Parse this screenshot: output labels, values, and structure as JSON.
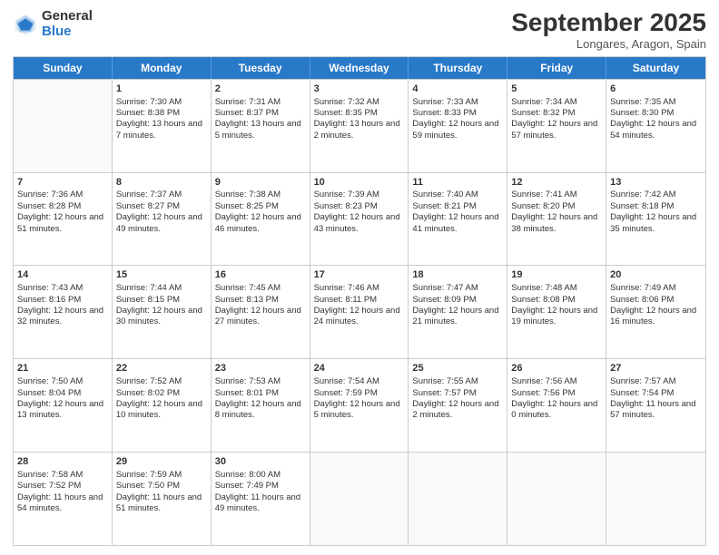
{
  "logo": {
    "general": "General",
    "blue": "Blue"
  },
  "header": {
    "month": "September 2025",
    "location": "Longares, Aragon, Spain"
  },
  "weekdays": [
    "Sunday",
    "Monday",
    "Tuesday",
    "Wednesday",
    "Thursday",
    "Friday",
    "Saturday"
  ],
  "rows": [
    [
      {
        "day": "",
        "empty": true
      },
      {
        "day": "1",
        "sunrise": "Sunrise: 7:30 AM",
        "sunset": "Sunset: 8:38 PM",
        "daylight": "Daylight: 13 hours and 7 minutes."
      },
      {
        "day": "2",
        "sunrise": "Sunrise: 7:31 AM",
        "sunset": "Sunset: 8:37 PM",
        "daylight": "Daylight: 13 hours and 5 minutes."
      },
      {
        "day": "3",
        "sunrise": "Sunrise: 7:32 AM",
        "sunset": "Sunset: 8:35 PM",
        "daylight": "Daylight: 13 hours and 2 minutes."
      },
      {
        "day": "4",
        "sunrise": "Sunrise: 7:33 AM",
        "sunset": "Sunset: 8:33 PM",
        "daylight": "Daylight: 12 hours and 59 minutes."
      },
      {
        "day": "5",
        "sunrise": "Sunrise: 7:34 AM",
        "sunset": "Sunset: 8:32 PM",
        "daylight": "Daylight: 12 hours and 57 minutes."
      },
      {
        "day": "6",
        "sunrise": "Sunrise: 7:35 AM",
        "sunset": "Sunset: 8:30 PM",
        "daylight": "Daylight: 12 hours and 54 minutes."
      }
    ],
    [
      {
        "day": "7",
        "sunrise": "Sunrise: 7:36 AM",
        "sunset": "Sunset: 8:28 PM",
        "daylight": "Daylight: 12 hours and 51 minutes."
      },
      {
        "day": "8",
        "sunrise": "Sunrise: 7:37 AM",
        "sunset": "Sunset: 8:27 PM",
        "daylight": "Daylight: 12 hours and 49 minutes."
      },
      {
        "day": "9",
        "sunrise": "Sunrise: 7:38 AM",
        "sunset": "Sunset: 8:25 PM",
        "daylight": "Daylight: 12 hours and 46 minutes."
      },
      {
        "day": "10",
        "sunrise": "Sunrise: 7:39 AM",
        "sunset": "Sunset: 8:23 PM",
        "daylight": "Daylight: 12 hours and 43 minutes."
      },
      {
        "day": "11",
        "sunrise": "Sunrise: 7:40 AM",
        "sunset": "Sunset: 8:21 PM",
        "daylight": "Daylight: 12 hours and 41 minutes."
      },
      {
        "day": "12",
        "sunrise": "Sunrise: 7:41 AM",
        "sunset": "Sunset: 8:20 PM",
        "daylight": "Daylight: 12 hours and 38 minutes."
      },
      {
        "day": "13",
        "sunrise": "Sunrise: 7:42 AM",
        "sunset": "Sunset: 8:18 PM",
        "daylight": "Daylight: 12 hours and 35 minutes."
      }
    ],
    [
      {
        "day": "14",
        "sunrise": "Sunrise: 7:43 AM",
        "sunset": "Sunset: 8:16 PM",
        "daylight": "Daylight: 12 hours and 32 minutes."
      },
      {
        "day": "15",
        "sunrise": "Sunrise: 7:44 AM",
        "sunset": "Sunset: 8:15 PM",
        "daylight": "Daylight: 12 hours and 30 minutes."
      },
      {
        "day": "16",
        "sunrise": "Sunrise: 7:45 AM",
        "sunset": "Sunset: 8:13 PM",
        "daylight": "Daylight: 12 hours and 27 minutes."
      },
      {
        "day": "17",
        "sunrise": "Sunrise: 7:46 AM",
        "sunset": "Sunset: 8:11 PM",
        "daylight": "Daylight: 12 hours and 24 minutes."
      },
      {
        "day": "18",
        "sunrise": "Sunrise: 7:47 AM",
        "sunset": "Sunset: 8:09 PM",
        "daylight": "Daylight: 12 hours and 21 minutes."
      },
      {
        "day": "19",
        "sunrise": "Sunrise: 7:48 AM",
        "sunset": "Sunset: 8:08 PM",
        "daylight": "Daylight: 12 hours and 19 minutes."
      },
      {
        "day": "20",
        "sunrise": "Sunrise: 7:49 AM",
        "sunset": "Sunset: 8:06 PM",
        "daylight": "Daylight: 12 hours and 16 minutes."
      }
    ],
    [
      {
        "day": "21",
        "sunrise": "Sunrise: 7:50 AM",
        "sunset": "Sunset: 8:04 PM",
        "daylight": "Daylight: 12 hours and 13 minutes."
      },
      {
        "day": "22",
        "sunrise": "Sunrise: 7:52 AM",
        "sunset": "Sunset: 8:02 PM",
        "daylight": "Daylight: 12 hours and 10 minutes."
      },
      {
        "day": "23",
        "sunrise": "Sunrise: 7:53 AM",
        "sunset": "Sunset: 8:01 PM",
        "daylight": "Daylight: 12 hours and 8 minutes."
      },
      {
        "day": "24",
        "sunrise": "Sunrise: 7:54 AM",
        "sunset": "Sunset: 7:59 PM",
        "daylight": "Daylight: 12 hours and 5 minutes."
      },
      {
        "day": "25",
        "sunrise": "Sunrise: 7:55 AM",
        "sunset": "Sunset: 7:57 PM",
        "daylight": "Daylight: 12 hours and 2 minutes."
      },
      {
        "day": "26",
        "sunrise": "Sunrise: 7:56 AM",
        "sunset": "Sunset: 7:56 PM",
        "daylight": "Daylight: 12 hours and 0 minutes."
      },
      {
        "day": "27",
        "sunrise": "Sunrise: 7:57 AM",
        "sunset": "Sunset: 7:54 PM",
        "daylight": "Daylight: 11 hours and 57 minutes."
      }
    ],
    [
      {
        "day": "28",
        "sunrise": "Sunrise: 7:58 AM",
        "sunset": "Sunset: 7:52 PM",
        "daylight": "Daylight: 11 hours and 54 minutes."
      },
      {
        "day": "29",
        "sunrise": "Sunrise: 7:59 AM",
        "sunset": "Sunset: 7:50 PM",
        "daylight": "Daylight: 11 hours and 51 minutes."
      },
      {
        "day": "30",
        "sunrise": "Sunrise: 8:00 AM",
        "sunset": "Sunset: 7:49 PM",
        "daylight": "Daylight: 11 hours and 49 minutes."
      },
      {
        "day": "",
        "empty": true
      },
      {
        "day": "",
        "empty": true
      },
      {
        "day": "",
        "empty": true
      },
      {
        "day": "",
        "empty": true
      }
    ]
  ]
}
